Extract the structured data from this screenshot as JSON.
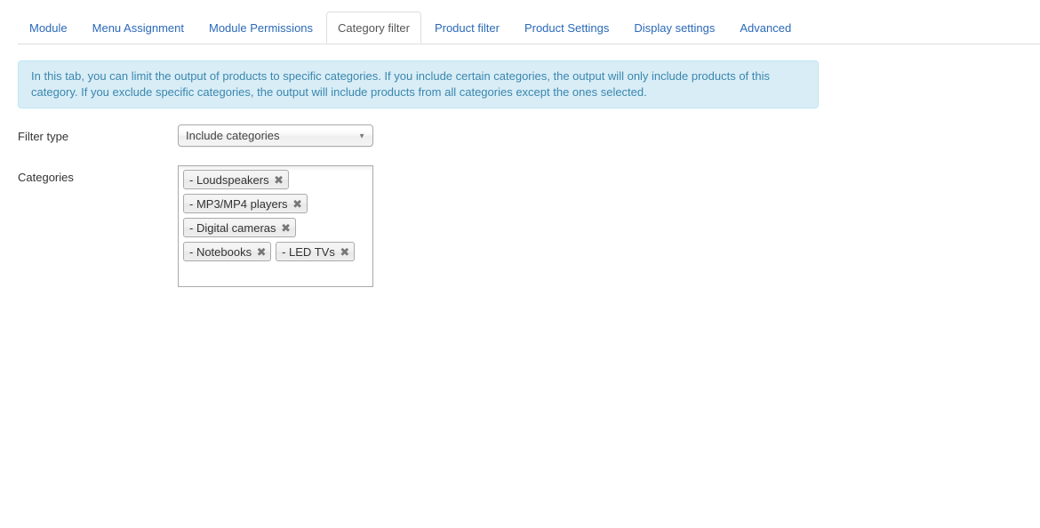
{
  "tabs": [
    {
      "label": "Module",
      "active": false
    },
    {
      "label": "Menu Assignment",
      "active": false
    },
    {
      "label": "Module Permissions",
      "active": false
    },
    {
      "label": "Category filter",
      "active": true
    },
    {
      "label": "Product filter",
      "active": false
    },
    {
      "label": "Product Settings",
      "active": false
    },
    {
      "label": "Display settings",
      "active": false
    },
    {
      "label": "Advanced",
      "active": false
    }
  ],
  "info": {
    "text": "In this tab, you can limit the output of products to specific categories. If you include certain categories, the output will only include products of this category. If you exclude specific categories, the output will include products from all categories except the ones selected."
  },
  "filter_type": {
    "label": "Filter type",
    "value": "Include categories",
    "arrow_icon": "▼"
  },
  "categories": {
    "label": "Categories",
    "remove_icon": "✖",
    "rows": [
      [
        "- Loudspeakers"
      ],
      [
        "- MP3/MP4 players"
      ],
      [
        "- Digital cameras"
      ],
      [
        "- Notebooks",
        "- LED TVs"
      ]
    ]
  },
  "colors": {
    "link": "#2a69b8",
    "info_bg": "#d9edf7",
    "info_text": "#3a87ad",
    "info_border": "#bce8f1"
  }
}
